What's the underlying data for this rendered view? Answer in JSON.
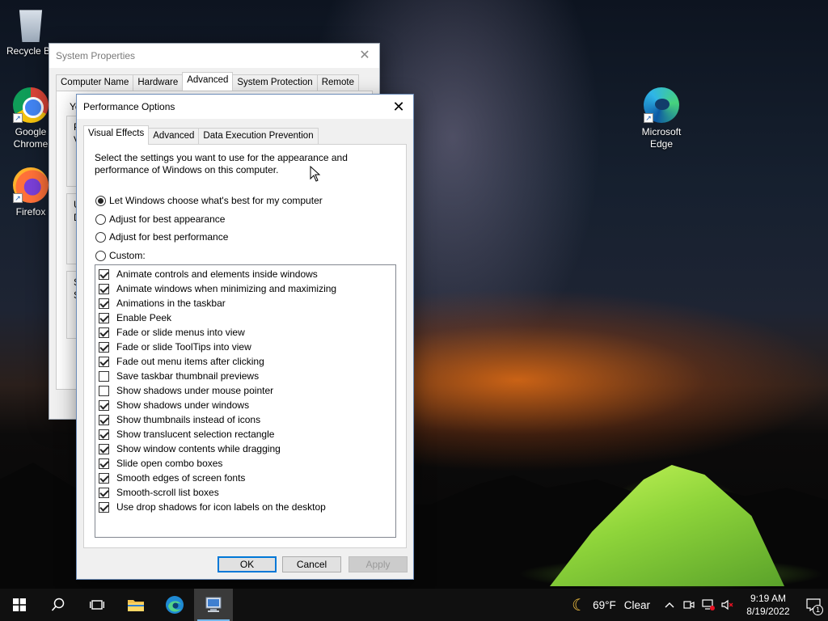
{
  "desktop": {
    "icons": [
      {
        "label": "Recycle Bin"
      },
      {
        "label": "Google Chrome"
      },
      {
        "label": "Firefox"
      },
      {
        "label": "Microsoft Edge"
      }
    ]
  },
  "system_properties": {
    "title": "System Properties",
    "tabs": [
      "Computer Name",
      "Hardware",
      "Advanced",
      "System Protection",
      "Remote"
    ],
    "active_tab": "Advanced",
    "partial_text": [
      "Yo",
      "P",
      "V",
      "U",
      "D",
      "S",
      "S"
    ]
  },
  "performance_options": {
    "title": "Performance Options",
    "tabs": [
      "Visual Effects",
      "Advanced",
      "Data Execution Prevention"
    ],
    "active_tab": "Visual Effects",
    "description": "Select the settings you want to use for the appearance and performance of Windows on this computer.",
    "radios": [
      {
        "label": "Let Windows choose what's best for my computer",
        "selected": true
      },
      {
        "label": "Adjust for best appearance",
        "selected": false
      },
      {
        "label": "Adjust for best performance",
        "selected": false
      },
      {
        "label": "Custom:",
        "selected": false
      }
    ],
    "effects": [
      {
        "label": "Animate controls and elements inside windows",
        "checked": true
      },
      {
        "label": "Animate windows when minimizing and maximizing",
        "checked": true
      },
      {
        "label": "Animations in the taskbar",
        "checked": true
      },
      {
        "label": "Enable Peek",
        "checked": true
      },
      {
        "label": "Fade or slide menus into view",
        "checked": true
      },
      {
        "label": "Fade or slide ToolTips into view",
        "checked": true
      },
      {
        "label": "Fade out menu items after clicking",
        "checked": true
      },
      {
        "label": "Save taskbar thumbnail previews",
        "checked": false
      },
      {
        "label": "Show shadows under mouse pointer",
        "checked": false
      },
      {
        "label": "Show shadows under windows",
        "checked": true
      },
      {
        "label": "Show thumbnails instead of icons",
        "checked": true
      },
      {
        "label": "Show translucent selection rectangle",
        "checked": true
      },
      {
        "label": "Show window contents while dragging",
        "checked": true
      },
      {
        "label": "Slide open combo boxes",
        "checked": true
      },
      {
        "label": "Smooth edges of screen fonts",
        "checked": true
      },
      {
        "label": "Smooth-scroll list boxes",
        "checked": true
      },
      {
        "label": "Use drop shadows for icon labels on the desktop",
        "checked": true
      }
    ],
    "buttons": {
      "ok": "OK",
      "cancel": "Cancel",
      "apply": "Apply"
    }
  },
  "taskbar": {
    "weather_temp": "69°F",
    "weather_cond": "Clear",
    "time": "9:19 AM",
    "date": "8/19/2022",
    "notification_count": "1"
  }
}
